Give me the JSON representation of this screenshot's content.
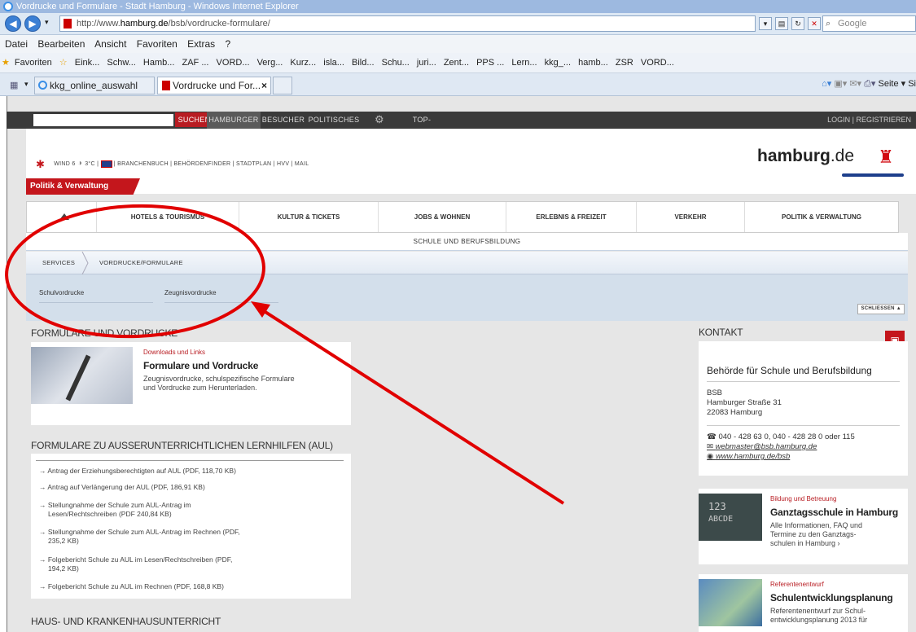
{
  "window": {
    "title": "Vordrucke und Formulare - Stadt Hamburg - Windows Internet Explorer"
  },
  "address_bar": {
    "url_prefix": "http://www.",
    "url_domain": "hamburg.de",
    "url_path": "/bsb/vordrucke-formulare/",
    "search_placeholder": "Google"
  },
  "menu": [
    "Datei",
    "Bearbeiten",
    "Ansicht",
    "Favoriten",
    "Extras",
    "?"
  ],
  "favorites": {
    "label": "Favoriten",
    "items": [
      "Eink...",
      "Schw...",
      "Hamb...",
      "ZAF ...",
      "VORD...",
      "Verg...",
      "Kurz...",
      "isla...",
      "Bild...",
      "Schu...",
      "juri...",
      "Zent...",
      "PPS ...",
      "Lern...",
      "kkg_...",
      "hamb...",
      "ZSR",
      "VORD..."
    ]
  },
  "tabs": [
    {
      "label": "kkg_online_auswahl"
    },
    {
      "label": "Vordrucke und For..."
    }
  ],
  "tab_tools": {
    "page": "Seite ▾",
    "safety": "Si"
  },
  "topbar": {
    "search_button": "SUCHEN",
    "items": [
      "HAMBURGER",
      "BESUCHER",
      "POLITISCHES"
    ],
    "top_services": "TOP-SERVICES",
    "login": "LOGIN | REGISTRIEREN"
  },
  "header": {
    "wind": "WIND 6",
    "temp": "3°C",
    "links": "BRANCHENBUCH | BEHÖRDENFINDER | STADTPLAN | HVV | MAIL",
    "logo": "hamburg",
    "logo_suffix": ".de",
    "section_badge": "Politik & Verwaltung"
  },
  "main_nav": [
    "HOTELS & TOURISMUS",
    "KULTUR & TICKETS",
    "JOBS & WOHNEN",
    "ERLEBNIS & FREIZEIT",
    "VERKEHR",
    "POLITIK & VERWALTUNG"
  ],
  "subhead": "SCHULE UND BERUFSBILDUNG",
  "breadcrumbs": [
    "SERVICES",
    "VORDRUCKE/FORMULARE"
  ],
  "sublinks": [
    "Schulvordrucke",
    "Zeugnisvordrucke"
  ],
  "close_label": "SCHLIESSEN",
  "sections": {
    "formulare": "FORMULARE UND VORDRUCKE",
    "aul": "FORMULARE ZU AUSSERUNTERRICHTLICHEN LERNHILFEN (AUL)",
    "haus": "HAUS- UND KRANKENHAUSUNTERRICHT",
    "kontakt": "KONTAKT"
  },
  "card_formulare": {
    "kicker": "Downloads und Links",
    "title": "Formulare und Vordrucke",
    "desc1": "Zeugnisvordrucke, schulspezifische Formulare",
    "desc2": "und Vordrucke zum Herunterladen."
  },
  "aul_list": [
    {
      "l1": "→ Antrag der Erziehungsberechtigten auf AUL (PDF, 118,70 KB)",
      "l2": ""
    },
    {
      "l1": "→ Antrag auf Verlängerung der AUL (PDF, 186,91 KB)",
      "l2": ""
    },
    {
      "l1": "→ Stellungnahme der Schule zum AUL-Antrag im",
      "l2": "Lesen/Rechtschreiben (PDF 240,84 KB)"
    },
    {
      "l1": "→ Stellungnahme der Schule zum AUL-Antrag im Rechnen (PDF,",
      "l2": "235,2 KB)"
    },
    {
      "l1": "→ Folgebericht Schule zu AUL im Lesen/Rechtschreiben (PDF,",
      "l2": "194,2 KB)"
    },
    {
      "l1": "→ Folgebericht Schule zu AUL im Rechnen (PDF, 168,8 KB)",
      "l2": ""
    }
  ],
  "kontakt": {
    "org": "Behörde für Schule und Berufsbildung",
    "abbr": "BSB",
    "street": "Hamburger Straße 31",
    "city": "22083 Hamburg",
    "phone": "040 - 428 63 0, 040 - 428 28 0 oder 115",
    "email": "webmaster@bsb.hamburg.de",
    "web": "www.hamburg.de/bsb"
  },
  "card_ganztag": {
    "kicker": "Bildung und Betreuung",
    "title": "Ganztagsschule in Hamburg",
    "d1": "Alle Informationen, FAQ und",
    "d2": "Termine zu den Ganztags-",
    "d3": "schulen in Hamburg ›",
    "chalk1": "123",
    "chalk2": "ABCDE"
  },
  "card_ref": {
    "kicker": "Referentenentwurf",
    "title": "Schulentwicklungsplanung",
    "d1": "Referentenentwurf zur Schul-",
    "d2": "entwicklungsplanung 2013 für"
  },
  "colors": {
    "accent_red": "#c4161c",
    "annotation_red": "#e10000",
    "logo_blue": "#1e3f8c"
  }
}
